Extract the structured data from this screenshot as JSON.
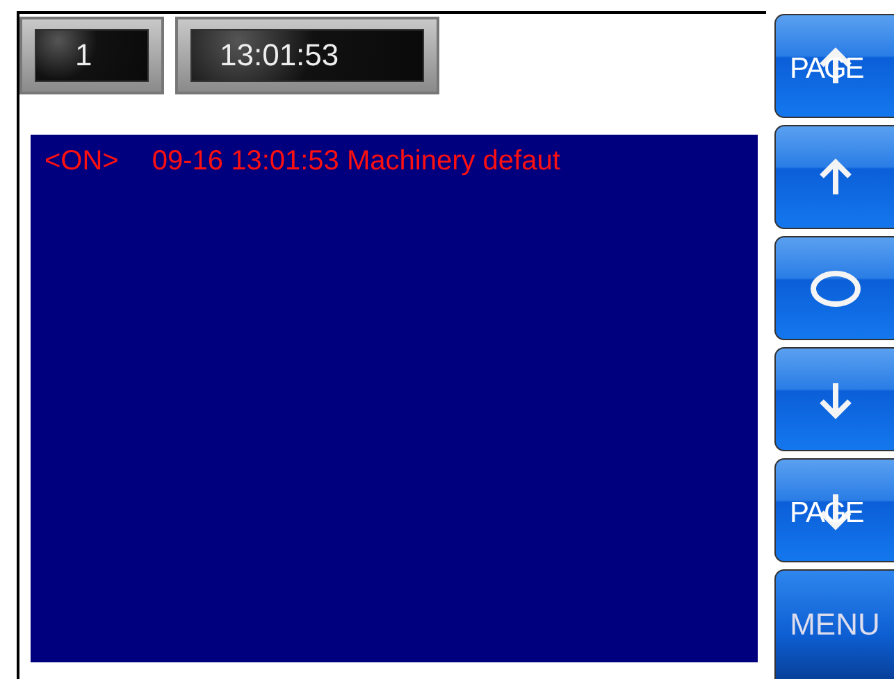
{
  "counter": {
    "value": "1"
  },
  "clock": {
    "value": "13:01:53"
  },
  "alarms": [
    {
      "status": "<ON>",
      "text": "09-16 13:01:53 Machinery defaut"
    }
  ],
  "buttons": [
    {
      "kind": "page-up",
      "label": "PAGE"
    },
    {
      "kind": "up"
    },
    {
      "kind": "select"
    },
    {
      "kind": "down"
    },
    {
      "kind": "page-down",
      "label": "PAGE"
    },
    {
      "kind": "menu",
      "label": "MENU"
    }
  ]
}
